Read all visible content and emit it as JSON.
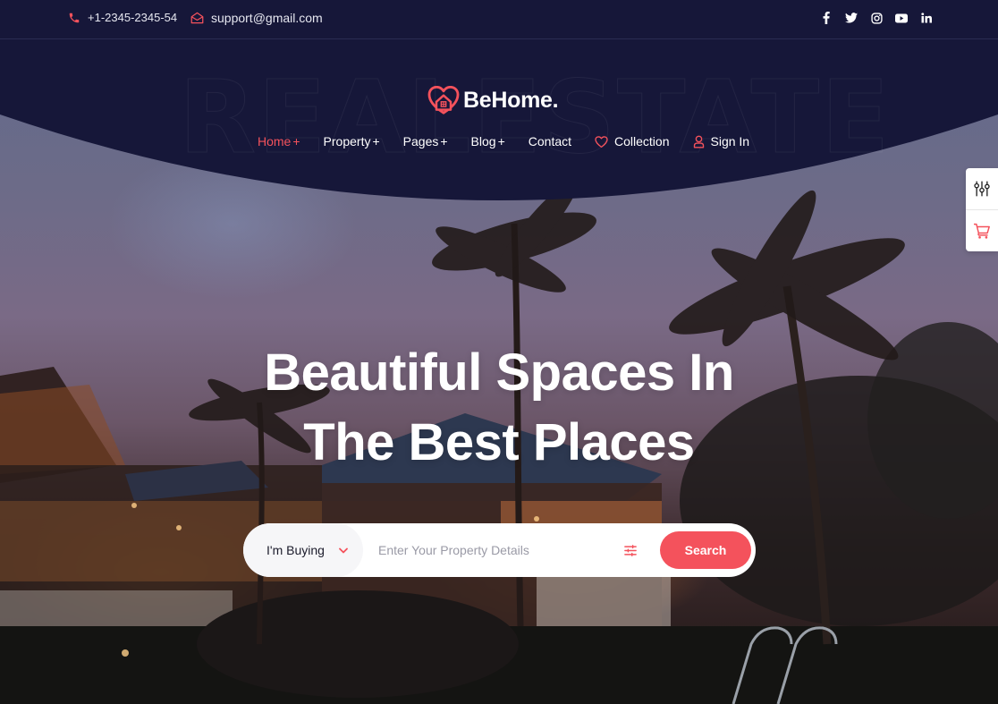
{
  "topbar": {
    "phone": "+1-2345-2345-54",
    "email": "support@gmail.com",
    "socials": [
      "facebook",
      "twitter",
      "instagram",
      "youtube",
      "linkedin"
    ]
  },
  "brand": {
    "name": "BeHome.",
    "watermark": "REALESTATE"
  },
  "nav": {
    "items": [
      {
        "label": "Home",
        "suffix": "+",
        "active": true
      },
      {
        "label": "Property",
        "suffix": "+"
      },
      {
        "label": "Pages",
        "suffix": "+"
      },
      {
        "label": "Blog",
        "suffix": "+"
      },
      {
        "label": "Contact",
        "suffix": ""
      },
      {
        "label": "Collection",
        "icon": "heart-icon"
      },
      {
        "label": "Sign In",
        "icon": "user-icon"
      }
    ]
  },
  "side_widget": {
    "items": [
      "settings-sliders-icon",
      "cart-icon"
    ]
  },
  "hero": {
    "title_line1": "Beautiful Spaces In",
    "title_line2": "The Best Places"
  },
  "search": {
    "type_selected": "I'm Buying",
    "placeholder": "Enter Your Property Details",
    "value": "",
    "button_label": "Search"
  },
  "colors": {
    "accent": "#f4525c",
    "navy": "#161739",
    "white": "#ffffff"
  }
}
